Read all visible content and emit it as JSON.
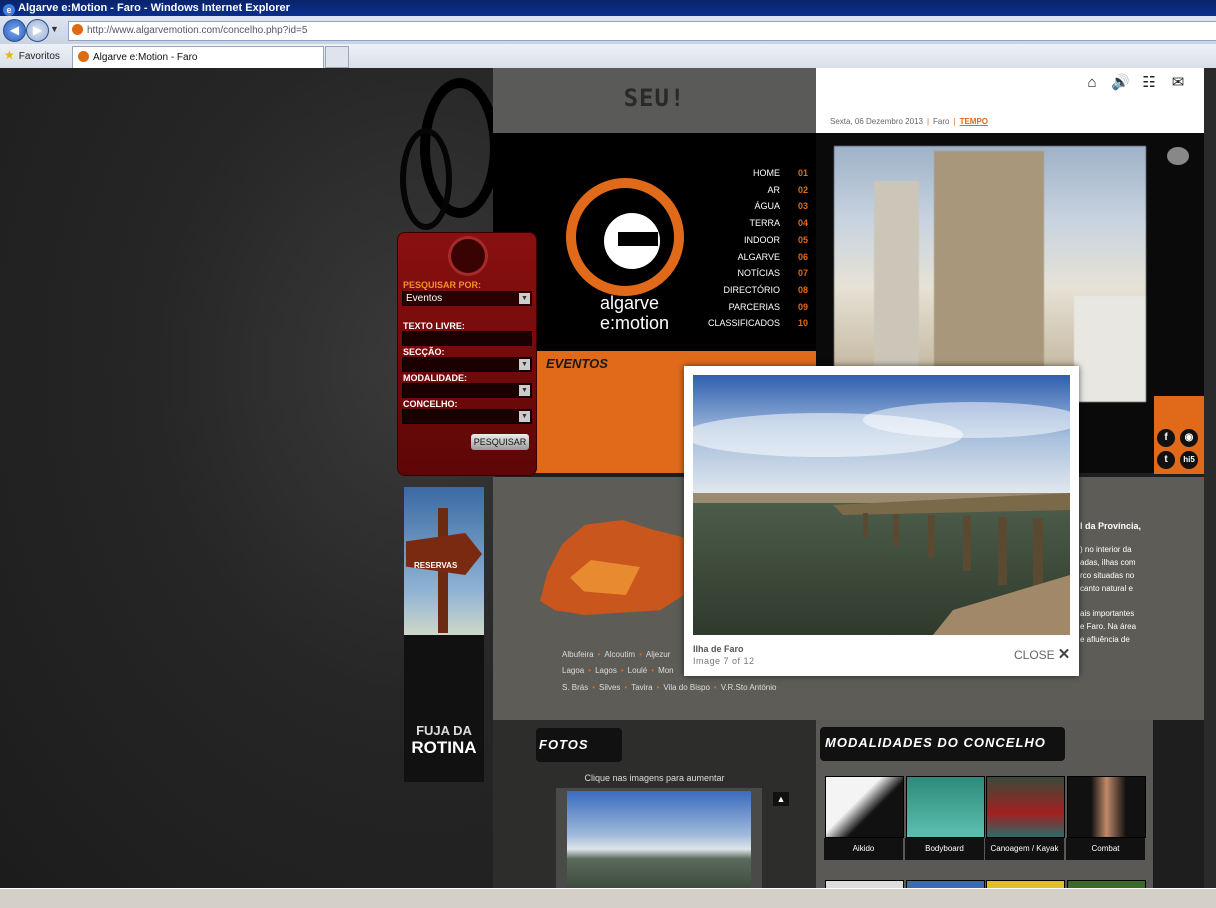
{
  "browser": {
    "window_title": "Algarve e:Motion - Faro - Windows Internet Explorer",
    "url": "http://www.algarvemotion.com/concelho.php?id=5",
    "favorites_label": "Favoritos",
    "tab_title": "Algarve e:Motion - Faro"
  },
  "banner": {
    "text": "SEU!"
  },
  "topbar": {
    "date": "Sexta, 06 Dezembro 2013",
    "location": "Faro",
    "tempo": "TEMPO"
  },
  "logo": {
    "line1": "algarve",
    "line2": "e:motion"
  },
  "menu": [
    {
      "label": "HOME",
      "num": "01"
    },
    {
      "label": "AR",
      "num": "02"
    },
    {
      "label": "ÁGUA",
      "num": "03"
    },
    {
      "label": "TERRA",
      "num": "04"
    },
    {
      "label": "INDOOR",
      "num": "05"
    },
    {
      "label": "ALGARVE",
      "num": "06"
    },
    {
      "label": "NOTÍCIAS",
      "num": "07"
    },
    {
      "label": "DIRECTÓRIO",
      "num": "08"
    },
    {
      "label": "PARCERIAS",
      "num": "09"
    },
    {
      "label": "CLASSIFICADOS",
      "num": "10"
    }
  ],
  "search": {
    "pesquisar_por": "PESQUISAR POR:",
    "selected": "Eventos",
    "texto_livre": "TEXTO LIVRE:",
    "seccao": "SECÇÃO:",
    "modalidade": "MODALIDADE:",
    "concelho": "CONCELHO:",
    "button": "PESQUISAR"
  },
  "section_title": "EVENTOS",
  "sign": {
    "reservas": "RESERVAS",
    "line1": "FUJA DA",
    "line2": "ROTINA"
  },
  "concelhos": {
    "row1": [
      "Albufeira",
      "Alcoutim",
      "Aljezur"
    ],
    "row2": [
      "Lagoa",
      "Lagos",
      "Loulé",
      "Mon"
    ],
    "row3": [
      "S. Brás",
      "Silves",
      "Tavira",
      "Vila do Bispo",
      "V.R.Sto António"
    ]
  },
  "content_text": {
    "l1": "l da Província,",
    "l2": ") no interior da",
    "l3": "adas, ilhas com",
    "l4": "rco situadas no",
    "l5": "cantο natural e",
    "l6": "ais importantes",
    "l7": "e Faro. Na área",
    "l8": "e afluência de"
  },
  "fotos": {
    "title": "FOTOS",
    "hint": "Clique nas imagens para aumentar",
    "up": "▲"
  },
  "modalidades": {
    "title": "MODALIDADES DO CONCELHO",
    "items": [
      "Aikido",
      "Bodyboard",
      "Canoagem / Kayak",
      "Combat"
    ]
  },
  "lightbox": {
    "caption": "Ilha de Faro",
    "count": "Image 7 of 12",
    "close": "CLOSE"
  },
  "colors": {
    "accent": "#e06a1a",
    "dark_red": "#7a0a0a"
  }
}
